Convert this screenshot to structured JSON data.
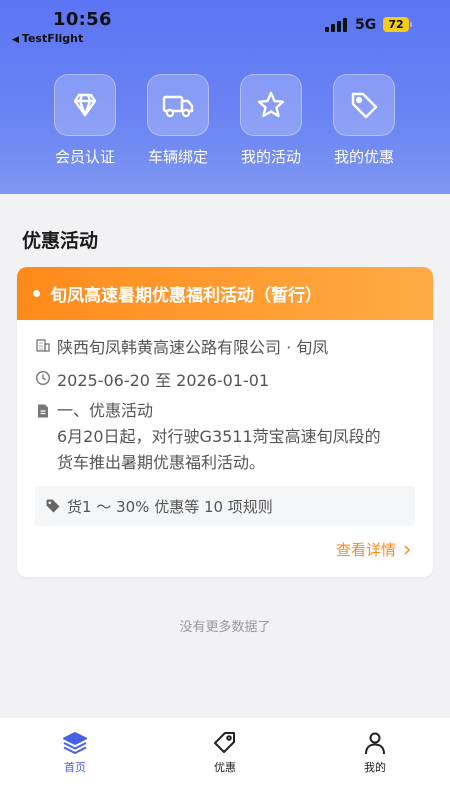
{
  "status_bar": {
    "time": "10:56",
    "back_app": "TestFlight",
    "network": "5G",
    "battery": "72"
  },
  "quick_actions": [
    {
      "label": "会员认证",
      "icon": "diamond-icon"
    },
    {
      "label": "车辆绑定",
      "icon": "truck-icon"
    },
    {
      "label": "我的活动",
      "icon": "star-icon"
    },
    {
      "label": "我的优惠",
      "icon": "tag-icon"
    }
  ],
  "section_title": "优惠活动",
  "promotion": {
    "title": "旬凤高速暑期优惠福利活动（暂行）",
    "company": "陕西旬凤韩黄高速公路有限公司 · 旬凤",
    "date_range": "2025-06-20 至 2026-01-01",
    "description": [
      "一、优惠活动",
      "6月20日起，对行驶G3511菏宝高速旬凤段的",
      "货车推出暑期优惠福利活动。"
    ],
    "rules": "货1 ～ 30% 优惠等 10 项规则",
    "detail_link": "查看详情"
  },
  "no_more": "没有更多数据了",
  "tabs": [
    {
      "label": "首页",
      "icon": "layers-icon",
      "active": true
    },
    {
      "label": "优惠",
      "icon": "tag-icon",
      "active": false
    },
    {
      "label": "我的",
      "icon": "person-icon",
      "active": false
    }
  ],
  "colors": {
    "primary": "#5b75f5",
    "accent": "#ff8a1a",
    "active_tab": "#4661e6"
  }
}
